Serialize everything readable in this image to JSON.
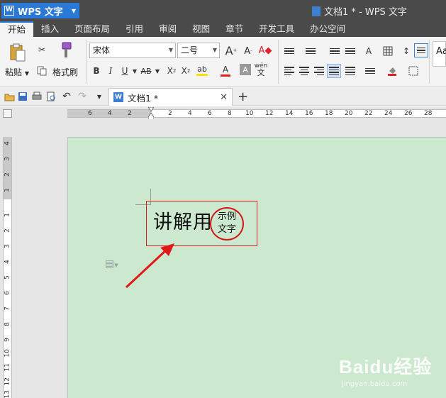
{
  "app": {
    "name": "WPS 文字",
    "window_title": "文档1 * - WPS 文字"
  },
  "menu": {
    "tabs": [
      "开始",
      "插入",
      "页面布局",
      "引用",
      "审阅",
      "视图",
      "章节",
      "开发工具",
      "办公空间"
    ],
    "active": "开始"
  },
  "ribbon": {
    "paste_label": "粘贴",
    "format_painter_label": "格式刷",
    "font_name": "宋体",
    "font_size": "二号",
    "style_preview": "Aa"
  },
  "document_tab": {
    "title": "文档1 *"
  },
  "rulers": {
    "horizontal": [
      "6",
      "4",
      "2",
      "2",
      "4",
      "6",
      "8",
      "10",
      "12",
      "14",
      "16",
      "18",
      "20",
      "22",
      "24",
      "26",
      "28"
    ],
    "vertical": [
      "4",
      "3",
      "2",
      "1",
      "1",
      "2",
      "3",
      "4",
      "5",
      "6",
      "7",
      "8",
      "9",
      "10",
      "11",
      "12",
      "13"
    ]
  },
  "document": {
    "main_text": "讲解用",
    "combined_chars_line1": "示例",
    "combined_chars_line2": "文字"
  },
  "colors": {
    "accent": "#2b79d7",
    "page_background": "#cce8cf",
    "highlight": "#d01818"
  },
  "watermark": {
    "logo": "Baidu经验",
    "url": "jingyan.baidu.com"
  }
}
